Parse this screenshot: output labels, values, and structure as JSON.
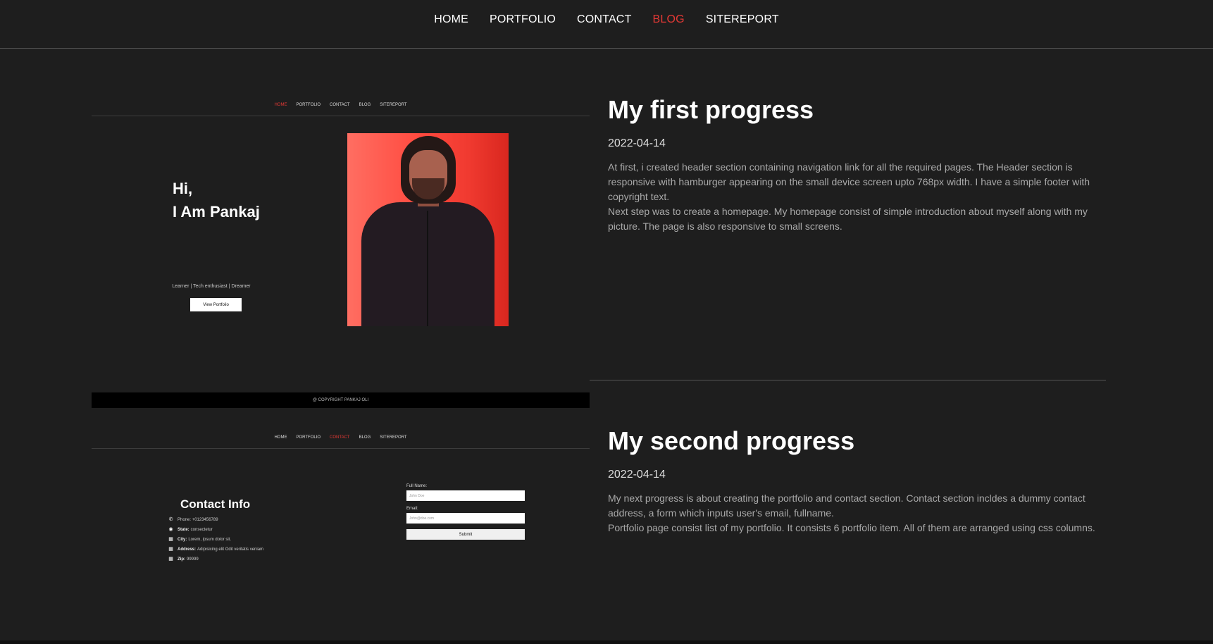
{
  "nav": {
    "items": [
      {
        "label": "HOME",
        "active": false
      },
      {
        "label": "PORTFOLIO",
        "active": false
      },
      {
        "label": "CONTACT",
        "active": false
      },
      {
        "label": "BLOG",
        "active": true
      },
      {
        "label": "SITEREPORT",
        "active": false
      }
    ],
    "accent_color": "#e53935"
  },
  "posts": [
    {
      "title": "My first progress",
      "date": "2022-04-14",
      "paragraphs": [
        "At first, i created header section containing navigation link for all the required pages. The Header section is responsive with hamburger appearing on the small device screen upto 768px width. I have a simple footer with copyright text.",
        "Next step was to create a homepage. My homepage consist of simple introduction about myself along with my picture. The page is also responsive to small screens."
      ],
      "thumbnail": {
        "nav": [
          "HOME",
          "PORTFOLIO",
          "CONTACT",
          "BLOG",
          "SITEREPORT"
        ],
        "active": "HOME",
        "greeting": "Hi,",
        "name": "I Am Pankaj",
        "tagline": "Learner | Tech enthusiast | Dreamer",
        "button": "View Portfolio",
        "footer": "@ COPYRIGHT PANKAJ OLI"
      }
    },
    {
      "title": "My second progress",
      "date": "2022-04-14",
      "paragraphs": [
        "My next progress is about creating the portfolio and contact section. Contact section incldes a dummy contact address, a form which inputs user's email, fullname.",
        "Portfolio page consist list of my portfolio. It consists 6 portfolio item. All of them are arranged using css columns."
      ],
      "thumbnail": {
        "nav": [
          "HOME",
          "PORTFOLIO",
          "CONTACT",
          "BLOG",
          "SITEREPORT"
        ],
        "active": "CONTACT",
        "contact_title": "Contact Info",
        "contact_rows": [
          {
            "icon": "phone-icon",
            "key": "",
            "value": "Phone: +0123456789"
          },
          {
            "icon": "globe-icon",
            "key": "State:",
            "value": "consectetur"
          },
          {
            "icon": "building-icon",
            "key": "City:",
            "value": "Lorem, ipsum dolor sit."
          },
          {
            "icon": "building-icon",
            "key": "Address:",
            "value": "Adipisicing elit Odit veritatis veniam"
          },
          {
            "icon": "building-icon",
            "key": "Zip:",
            "value": "99999"
          }
        ],
        "form": {
          "fullname_label": "Full Name:",
          "fullname_placeholder": "John Doe",
          "email_label": "Email:",
          "email_placeholder": "John@doe.com",
          "submit": "Submit"
        }
      }
    }
  ]
}
